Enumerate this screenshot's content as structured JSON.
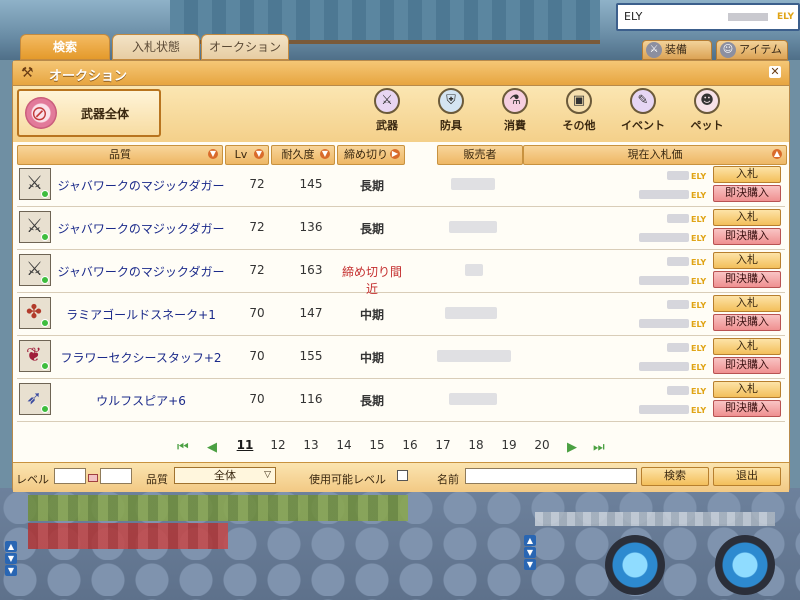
{
  "ely_box": {
    "label": "ELY",
    "unit": "ELY"
  },
  "top_tabs": [
    "検索",
    "入札状態",
    "オークション"
  ],
  "right_tabs": [
    "装備",
    "アイテム"
  ],
  "window": {
    "title": "オークション"
  },
  "selected_category": "武器全体",
  "categories": [
    "武器",
    "防具",
    "消費",
    "その他",
    "イベント",
    "ペット"
  ],
  "columns": [
    "品質",
    "Lv",
    "耐久度",
    "締め切り",
    "販売者",
    "現在入札価"
  ],
  "rows": [
    {
      "name": "ジャバワークのマジックダガー",
      "lv": "72",
      "durability": "145",
      "deadline": "長期",
      "deadline_color": "normal"
    },
    {
      "name": "ジャバワークのマジックダガー",
      "lv": "72",
      "durability": "136",
      "deadline": "長期",
      "deadline_color": "normal"
    },
    {
      "name": "ジャバワークのマジックダガー",
      "lv": "72",
      "durability": "163",
      "deadline": "締め切り間近",
      "deadline_color": "red"
    },
    {
      "name": "ラミアゴールドスネーク+1",
      "lv": "70",
      "durability": "147",
      "deadline": "中期",
      "deadline_color": "normal"
    },
    {
      "name": "フラワーセクシースタッフ+2",
      "lv": "70",
      "durability": "155",
      "deadline": "中期",
      "deadline_color": "normal"
    },
    {
      "name": "ウルフスピア+6",
      "lv": "70",
      "durability": "116",
      "deadline": "長期",
      "deadline_color": "normal"
    }
  ],
  "currency": "ELY",
  "bid_label": "入札",
  "buy_label": "即決購入",
  "pagination": {
    "pages": [
      "11",
      "12",
      "13",
      "14",
      "15",
      "16",
      "17",
      "18",
      "19",
      "20"
    ],
    "current": "11"
  },
  "search": {
    "level_label": "レベル",
    "quality_label": "品質",
    "quality_value": "全体",
    "usable_level_label": "使用可能レベル",
    "name_label": "名前",
    "search_button": "検索",
    "exit_button": "退出"
  }
}
